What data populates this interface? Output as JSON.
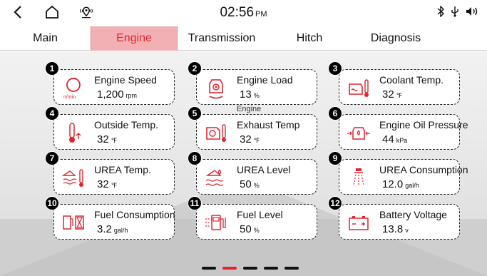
{
  "status_bar": {
    "time": "02:56",
    "ampm": "PM",
    "icons": [
      "back-icon",
      "home-icon",
      "location-icon",
      "bluetooth-icon",
      "usb-icon",
      "volume-icon"
    ]
  },
  "tabs": [
    {
      "label": "Main",
      "active": false
    },
    {
      "label": "Engine",
      "active": true
    },
    {
      "label": "Transmission",
      "active": false
    },
    {
      "label": "Hitch",
      "active": false
    },
    {
      "label": "Diagnosis",
      "active": false
    }
  ],
  "cards": [
    {
      "num": "1",
      "label": "Engine Speed",
      "value": "1,200",
      "unit": "rpm",
      "icon": "engine-speed-icon",
      "icon_text": "n/min"
    },
    {
      "num": "2",
      "label": "Engine Load",
      "value": "13",
      "unit": "%",
      "icon": "engine-load-icon"
    },
    {
      "num": "3",
      "label": "Coolant Temp.",
      "value": "32",
      "unit": "℉",
      "icon": "coolant-temp-icon"
    },
    {
      "num": "4",
      "label": "Outside Temp.",
      "value": "32",
      "unit": "℉",
      "icon": "outside-temp-icon"
    },
    {
      "num": "5",
      "label": "Exhaust Temp",
      "value": "32",
      "unit": "℉",
      "icon": "exhaust-temp-icon",
      "sup": "Engine"
    },
    {
      "num": "6",
      "label": "Engine Oil Pressure",
      "value": "44",
      "unit": "kPa",
      "icon": "engine-oil-pressure-icon"
    },
    {
      "num": "7",
      "label": "UREA Temp.",
      "value": "32",
      "unit": "℉",
      "icon": "urea-temp-icon"
    },
    {
      "num": "8",
      "label": "UREA Level",
      "value": "50",
      "unit": "%",
      "icon": "urea-level-icon"
    },
    {
      "num": "9",
      "label": "UREA Consumption",
      "value": "12.0",
      "unit": "gal/h",
      "icon": "urea-consumption-icon"
    },
    {
      "num": "10",
      "label": "Fuel Consumption",
      "value": "3.2",
      "unit": "gal/h",
      "icon": "fuel-consumption-icon"
    },
    {
      "num": "11",
      "label": "Fuel Level",
      "value": "50",
      "unit": "%",
      "icon": "fuel-level-icon"
    },
    {
      "num": "12",
      "label": "Battery Voltage",
      "value": "13.8",
      "unit": "v",
      "icon": "battery-voltage-icon"
    }
  ],
  "pager": {
    "pages": 5,
    "active": 1
  },
  "colors": {
    "accent": "#e2242f",
    "tab_active_bg": "#f3b0b4"
  }
}
